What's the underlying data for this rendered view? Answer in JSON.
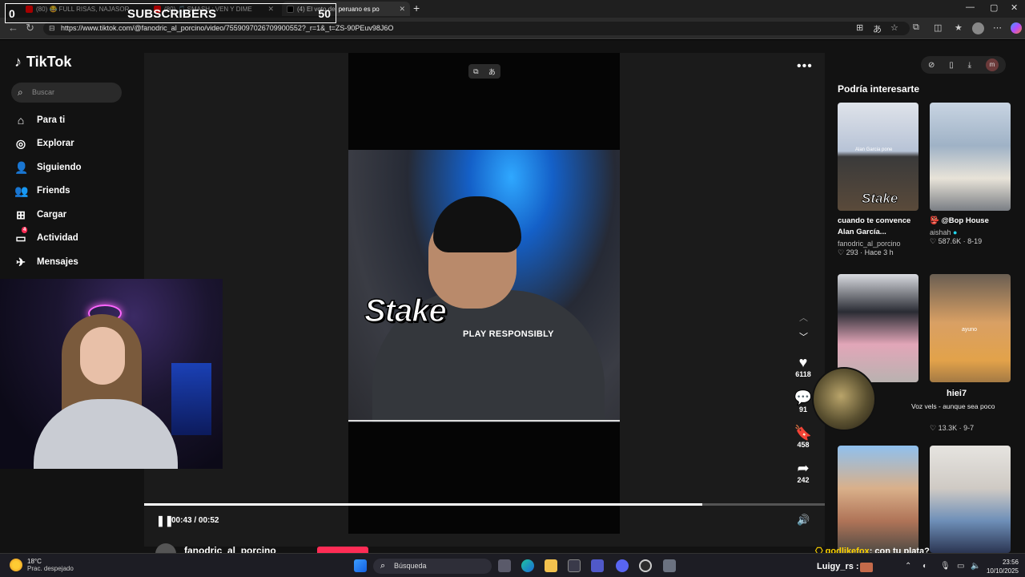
{
  "browser": {
    "tabs": [
      {
        "label": "(80) 😂 FULL RISAS, NAJASOR",
        "active": false
      },
      {
        "label": "(80) 🎵 SMASH : VEN Y DIME",
        "active": false
      },
      {
        "label": "(4) El voto del peruano es po",
        "active": true
      }
    ],
    "new_tab": "+",
    "url": "https://www.tiktok.com/@fanodric_al_porcino/video/7559097026709900552?_r=1&_t=ZS-90PEuv98J6O"
  },
  "overlay": {
    "left_count": "0",
    "label": "SUBSCRIBERS",
    "right_count": "50"
  },
  "sidebar": {
    "logo": "TikTok",
    "search_placeholder": "Buscar",
    "items": [
      {
        "label": "Para ti",
        "icon": "home-icon"
      },
      {
        "label": "Explorar",
        "icon": "compass-icon"
      },
      {
        "label": "Siguiendo",
        "icon": "user-follow-icon"
      },
      {
        "label": "Friends",
        "icon": "friends-icon"
      },
      {
        "label": "Cargar",
        "icon": "upload-icon"
      },
      {
        "label": "Actividad",
        "icon": "inbox-icon",
        "badge": "4"
      },
      {
        "label": "Mensajes",
        "icon": "message-icon"
      }
    ]
  },
  "video": {
    "caption_brand": "Stake",
    "caption_text": "PLAY RESPONSIBLY",
    "current_time": "00:43",
    "duration": "00:52",
    "time_display": "00:43 / 00:52",
    "progress": 0.82,
    "author": "fanodric_al_porcino",
    "actions": {
      "likes": "6118",
      "comments": "91",
      "saves": "458",
      "shares": "242"
    }
  },
  "right_panel": {
    "title": "Podría interesarte",
    "cards": [
      {
        "title": "cuando te convence Alan García...",
        "author": "fanodric_al_porcino",
        "meta": "♡ 293 · Hace 3 h"
      },
      {
        "title": "👺 @Bop House",
        "author": "aishah",
        "meta": "♡ 587.6K · 8-19"
      },
      {
        "title": "",
        "author": "",
        "meta": ""
      },
      {
        "title": "",
        "author": "",
        "meta": "♡ 13.3K · 9-7"
      },
      {
        "title": "",
        "author": "",
        "meta": ""
      },
      {
        "title": "",
        "author": "",
        "meta": ""
      }
    ],
    "thumb_text": {
      "card1_a": "Alan Garcia pone",
      "card1_stake": "Stake",
      "card4": "ayuno"
    }
  },
  "chat": {
    "name": "hiei7",
    "message": "Voz vels - aunque sea poco",
    "line2_user": "godlikefox",
    "line2_text": ": con tu plata?",
    "user2": "Luigy_rs :"
  },
  "taskbar": {
    "weather_temp": "18°C",
    "weather_desc": "Prac. despejado",
    "search_placeholder": "Búsqueda",
    "time": "23:56",
    "date": "10/10/2025"
  }
}
